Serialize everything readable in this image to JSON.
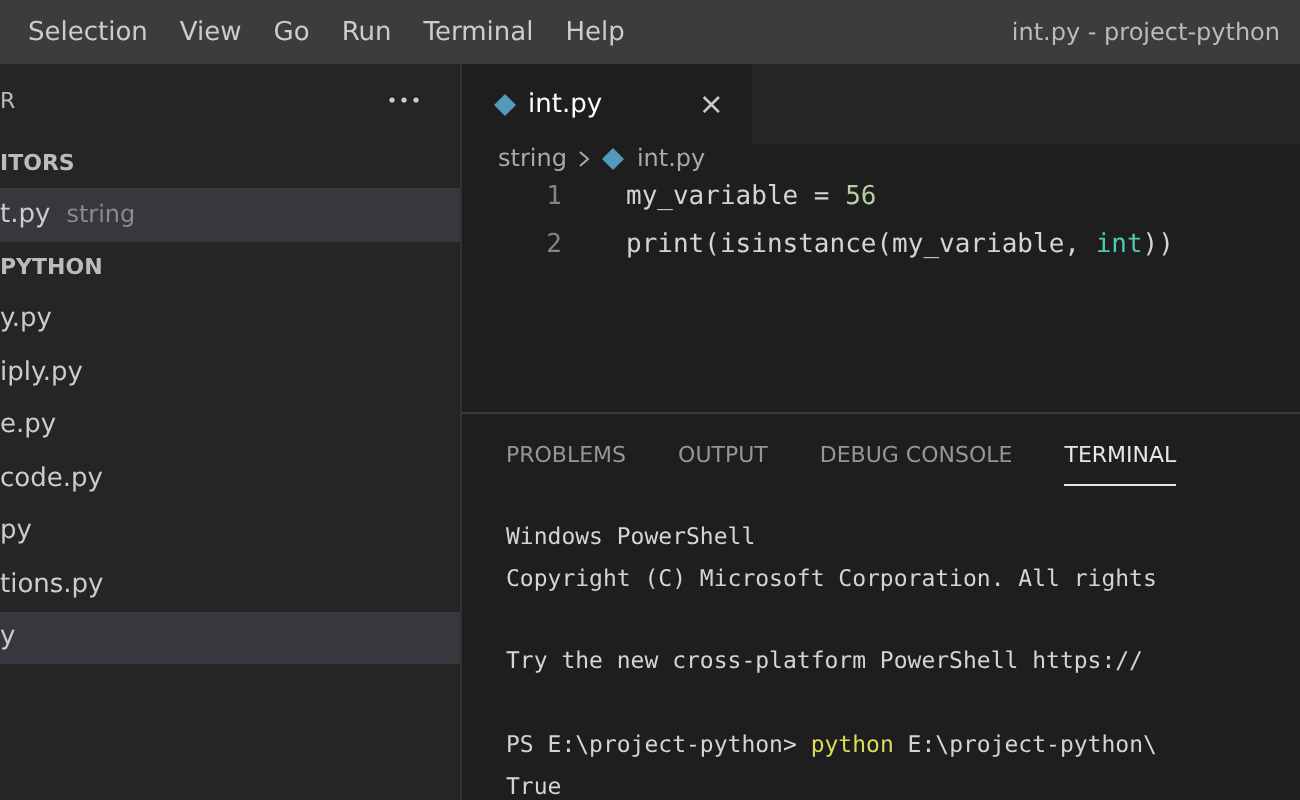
{
  "menu_bar": {
    "items": [
      "Selection",
      "View",
      "Go",
      "Run",
      "Terminal",
      "Help"
    ],
    "title": "int.py - project-python"
  },
  "sidebar": {
    "header": "R",
    "sections": [
      {
        "title": "ITORS",
        "items": [
          {
            "name": "t.py",
            "detail": "string",
            "selected": true
          }
        ]
      },
      {
        "title": "PYTHON",
        "items": [
          {
            "name": "y.py",
            "selected": false
          },
          {
            "name": "iply.py",
            "selected": false
          },
          {
            "name": "e.py",
            "selected": false
          },
          {
            "name": "code.py",
            "selected": false
          },
          {
            "name": "py",
            "selected": false
          },
          {
            "name": "tions.py",
            "selected": false
          },
          {
            "name": "y",
            "selected": true
          }
        ]
      }
    ]
  },
  "editor": {
    "tabs": [
      {
        "label": "int.py",
        "close": "×",
        "selected": true
      }
    ],
    "breadcrumbs": [
      "string",
      "int.py"
    ],
    "lines": [
      {
        "number": "1",
        "tokens": [
          {
            "text": "my_variable = ",
            "kind": "plain"
          },
          {
            "text": "56",
            "kind": "number"
          }
        ]
      },
      {
        "number": "2",
        "tokens": [
          {
            "text": "print(isinstance(my_variable, ",
            "kind": "plain"
          },
          {
            "text": "int",
            "kind": "type"
          },
          {
            "text": "))",
            "kind": "plain"
          }
        ]
      }
    ]
  },
  "panel": {
    "tabs": [
      {
        "label": "PROBLEMS",
        "selected": false
      },
      {
        "label": "OUTPUT",
        "selected": false
      },
      {
        "label": "DEBUG CONSOLE",
        "selected": false
      },
      {
        "label": "TERMINAL",
        "selected": true
      }
    ],
    "terminal": [
      {
        "blank_before": false,
        "tokens": [
          {
            "text": "Windows PowerShell",
            "kind": "plain"
          }
        ]
      },
      {
        "blank_before": false,
        "tokens": [
          {
            "text": "Copyright (C) Microsoft Corporation. All rights",
            "kind": "plain"
          }
        ]
      },
      {
        "blank_before": true,
        "tokens": [
          {
            "text": "Try the new cross-platform PowerShell https://",
            "kind": "plain"
          }
        ]
      },
      {
        "blank_before": true,
        "tokens": [
          {
            "text": "PS E:\\project-python> ",
            "kind": "plain"
          },
          {
            "text": "python",
            "kind": "command"
          },
          {
            "text": " E:\\project-python\\",
            "kind": "plain"
          }
        ]
      },
      {
        "blank_before": false,
        "tokens": [
          {
            "text": "True",
            "kind": "plain"
          }
        ]
      }
    ]
  }
}
